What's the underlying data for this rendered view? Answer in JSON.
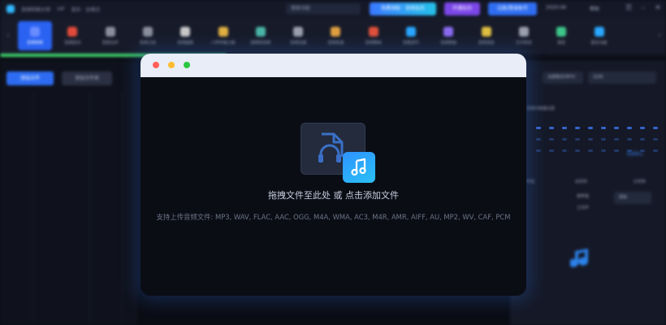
{
  "titlebar": {
    "app_name": "音频转换大师",
    "version": "VIP",
    "subtitle": "音乐 · 全格式",
    "search_placeholder": "搜索功能",
    "btn_a": "免费领取 · 音频会员",
    "btn_b": "开通会员",
    "btn_c": "注册/登录账号",
    "stat_1": "2020-06",
    "stat_2": "帮助"
  },
  "toolbar": {
    "tools": [
      {
        "label": "音频转换",
        "color": "#6a8cff"
      },
      {
        "label": "音频剪切",
        "color": "#e24a3b"
      },
      {
        "label": "音频合并",
        "color": "#8a8f9d"
      },
      {
        "label": "音频分割",
        "color": "#8a8f9d"
      },
      {
        "label": "音频提取",
        "color": "#c9c9c9"
      },
      {
        "label": "人声伴奏分离",
        "color": "#e0b040"
      },
      {
        "label": "视频转音频",
        "color": "#4bb5a8"
      },
      {
        "label": "音频压缩",
        "color": "#9aa0ad"
      },
      {
        "label": "音频变速",
        "color": "#e0a040"
      },
      {
        "label": "音频降噪",
        "color": "#e0503b"
      },
      {
        "label": "音量调节",
        "color": "#2aa7ff"
      },
      {
        "label": "音频倒放",
        "color": "#8a6af0"
      },
      {
        "label": "音频混音",
        "color": "#e0c040"
      },
      {
        "label": "文字转音",
        "color": "#9aa0ad"
      },
      {
        "label": "录音",
        "color": "#3ec78a"
      },
      {
        "label": "更多功能",
        "color": "#2aa7ff"
      }
    ],
    "progress": 0.34
  },
  "leftpanel": {
    "add_file": "添加文件",
    "add_folder": "添加文件夹"
  },
  "rightpanel": {
    "format_label": "格式",
    "format_value": "全部格式(MP3)",
    "quality_value": "320K",
    "eq_label": "音频均衡器设置",
    "reset_link": "恢复默认",
    "option_a": "声道",
    "option_b": "采样率",
    "option_c": "比特率",
    "radio_a": "单声道",
    "radio_b": "立体声",
    "select_c": "原始"
  },
  "modal": {
    "drop_title": "拖拽文件至此处 或 点击添加文件",
    "supported_formats": "支持上传音频文件: MP3, WAV, FLAC, AAC, OGG, M4A, WMA, AC3, M4R, AMR, AIFF, AU, MP2, WV, CAF, PCM"
  }
}
